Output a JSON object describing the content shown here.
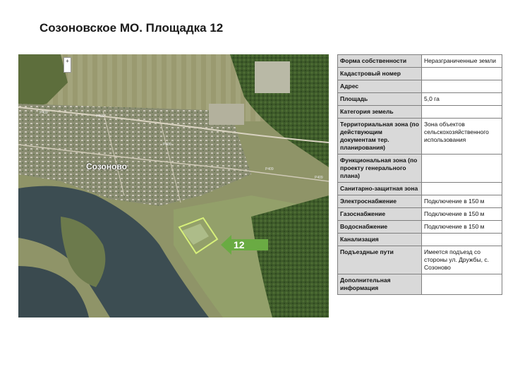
{
  "page": {
    "title": "Созоновское МО. Площадка 12"
  },
  "map": {
    "village_label": "Созоново",
    "site_number": "12",
    "zoom_control": "+",
    "road_labels": [
      "Р409",
      "Р409",
      "Р409",
      "Р409",
      "Р409"
    ]
  },
  "info_table": {
    "rows": [
      {
        "key": "Форма собственности",
        "value": "Неразграниченные земли"
      },
      {
        "key": "Кадастровый номер",
        "value": ""
      },
      {
        "key": "Адрес",
        "value": ""
      },
      {
        "key": "Площадь",
        "value": "5,0 га"
      },
      {
        "key": "Категория земель",
        "value": ""
      },
      {
        "key": "Территориальная зона (по действующим документам тер. планирования)",
        "value": "Зона объектов сельскохозяйственного использования"
      },
      {
        "key": "Функциональная зона (по проекту генерального плана)",
        "value": ""
      },
      {
        "key": "Санитарно-защитная зона",
        "value": ""
      },
      {
        "key": "Электроснабжение",
        "value": "Подключение в 150 м"
      },
      {
        "key": "Газоснабжение",
        "value": "Подключение в 150 м"
      },
      {
        "key": "Водоснабжение",
        "value": "Подключение в 150 м"
      },
      {
        "key": "Канализация",
        "value": ""
      },
      {
        "key": "Подъездные пути",
        "value": "Имеется подъезд со стороны ул. Дружбы, с. Созоново"
      },
      {
        "key": "Дополнительная информация",
        "value": ""
      }
    ]
  }
}
